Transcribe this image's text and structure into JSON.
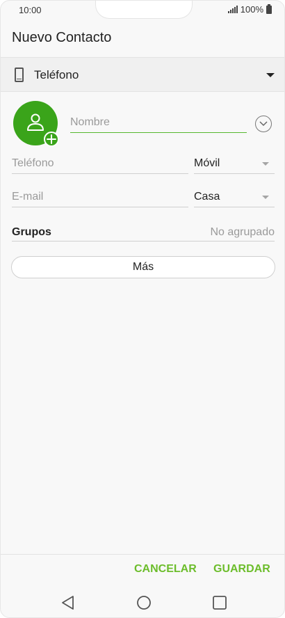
{
  "status_bar": {
    "time": "10:00",
    "battery": "100%"
  },
  "header": {
    "title": "Nuevo Contacto"
  },
  "account": {
    "label": "Teléfono",
    "icon": "phone-icon"
  },
  "form": {
    "name_placeholder": "Nombre",
    "phone_placeholder": "Teléfono",
    "phone_type": "Móvil",
    "email_placeholder": "E-mail",
    "email_type": "Casa",
    "groups_label": "Grupos",
    "groups_value": "No agrupado",
    "more_label": "Más"
  },
  "actions": {
    "cancel": "CANCELAR",
    "save": "GUARDAR"
  },
  "colors": {
    "accent": "#3aa41a",
    "action_text": "#6cbd2b",
    "underline_active": "#56b82e"
  }
}
